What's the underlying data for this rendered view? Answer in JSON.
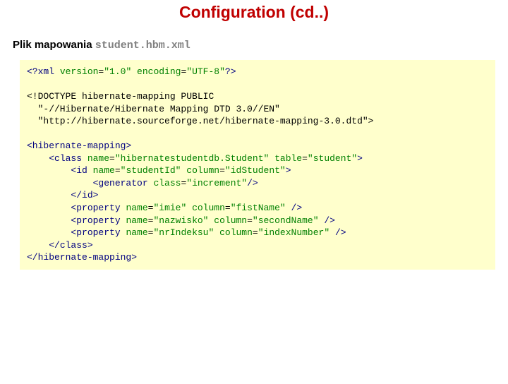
{
  "title": "Configuration (cd..)",
  "subtitle_prefix": "Plik mapowania ",
  "subtitle_filename": "student.hbm.xml",
  "code": {
    "l1a": "<?xml ",
    "l1b": "version",
    "l1c": "=",
    "l1d": "\"1.0\"",
    "l1e": " encoding",
    "l1f": "=",
    "l1g": "\"UTF-8\"",
    "l1h": "?>",
    "l2": "<!DOCTYPE hibernate-mapping PUBLIC",
    "l3": "  \"-//Hibernate/Hibernate Mapping DTD 3.0//EN\"",
    "l4": "  \"http://hibernate.sourceforge.net/hibernate-mapping-3.0.dtd\">",
    "l5": "<hibernate-mapping>",
    "l6pad": "    ",
    "l6a": "<class ",
    "l6b": "name",
    "l6c": "=",
    "l6d": "\"hibernatestudentdb.Student\"",
    "l6e": " table",
    "l6f": "=",
    "l6g": "\"student\"",
    "l6h": ">",
    "l7pad": "        ",
    "l7a": "<id ",
    "l7b": "name",
    "l7c": "=",
    "l7d": "\"studentId\"",
    "l7e": " column",
    "l7f": "=",
    "l7g": "\"idStudent\"",
    "l7h": ">",
    "l8pad": "            ",
    "l8a": "<generator ",
    "l8b": "class",
    "l8c": "=",
    "l8d": "\"increment\"",
    "l8e": "/>",
    "l9pad": "        ",
    "l9a": "</id>",
    "l10pad": "        ",
    "l10a": "<property ",
    "l10b": "name",
    "l10c": "=",
    "l10d": "\"imie\"",
    "l10e": " column",
    "l10f": "=",
    "l10g": "\"fistName\"",
    "l10h": " />",
    "l11pad": "        ",
    "l11a": "<property ",
    "l11b": "name",
    "l11c": "=",
    "l11d": "\"nazwisko\"",
    "l11e": " column",
    "l11f": "=",
    "l11g": "\"secondName\"",
    "l11h": " />",
    "l12pad": "        ",
    "l12a": "<property ",
    "l12b": "name",
    "l12c": "=",
    "l12d": "\"nrIndeksu\"",
    "l12e": " column",
    "l12f": "=",
    "l12g": "\"indexNumber\"",
    "l12h": " />",
    "l13pad": "    ",
    "l13a": "</class>",
    "l14": "</hibernate-mapping>"
  }
}
